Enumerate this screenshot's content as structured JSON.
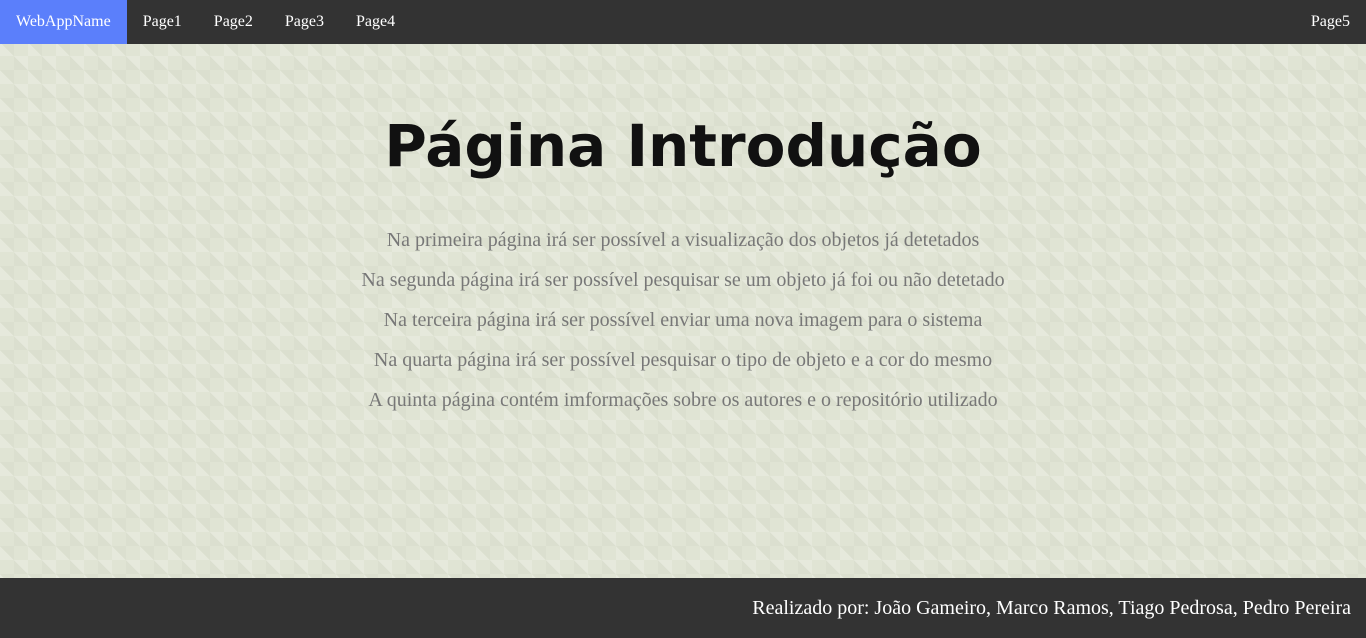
{
  "navbar": {
    "brand": "WebAppName",
    "left_items": [
      "Page1",
      "Page2",
      "Page3",
      "Page4"
    ],
    "right_item": "Page5"
  },
  "main": {
    "title": "Página Introdução",
    "lines": [
      "Na primeira página irá ser possível a visualização dos objetos já detetados",
      "Na segunda página irá ser possível pesquisar se um objeto já foi ou não detetado",
      "Na terceira página irá ser possível enviar uma nova imagem para o sistema",
      "Na quarta página irá ser possível pesquisar o tipo de objeto e a cor do mesmo",
      "A quinta página contém imformações sobre os autores e o repositório utilizado"
    ]
  },
  "footer": {
    "text": "Realizado por: João Gameiro, Marco Ramos, Tiago Pedrosa, Pedro Pereira"
  },
  "colors": {
    "navbar_bg": "#333333",
    "brand_bg": "#5b7ffb",
    "page_bg": "#e0e4d4",
    "title": "#111111",
    "body_text": "#777777"
  }
}
